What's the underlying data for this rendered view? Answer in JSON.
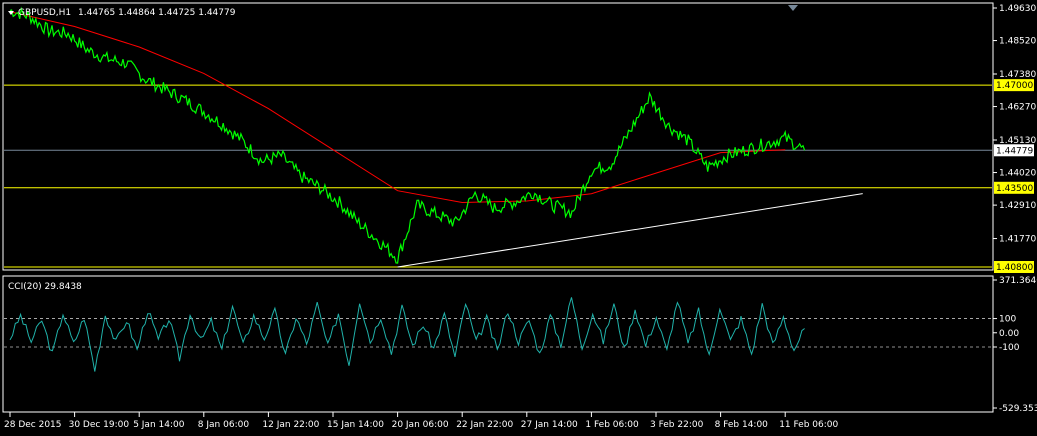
{
  "window": {
    "header_symbol": "GBPUSD,H1",
    "header_ohlc": "1.44765 1.44864 1.44725 1.44779",
    "cci_title": "CCI(20) 29.8438"
  },
  "colors": {
    "background": "#000000",
    "frame": "#ffffff",
    "price": "#00ff00",
    "ma": "#ff0000",
    "cci": "#20b2aa",
    "level_line": "#ffff00",
    "level_badge": "#ffff00",
    "current_line": "#778899",
    "current_badge": "#ffffff",
    "trendline": "#ffffff",
    "grid_dashed": "#c0c0c0"
  },
  "chart_data": [
    {
      "type": "line",
      "name_hint": "price",
      "ylim": [
        1.408,
        1.4963
      ],
      "y_ticks": [
        "1.49630",
        "1.48520",
        "1.47380",
        "1.46270",
        "1.45130",
        "1.44020",
        "1.42910",
        "1.41770"
      ],
      "x_tick_labels": [
        "28 Dec 2015",
        "30 Dec 19:00",
        "5 Jan 14:00",
        "8 Jan 06:00",
        "12 Jan 22:00",
        "15 Jan 14:00",
        "20 Jan 06:00",
        "22 Jan 22:00",
        "27 Jan 14:00",
        "1 Feb 06:00",
        "3 Feb 22:00",
        "8 Feb 14:00",
        "11 Feb 06:00"
      ],
      "x_tick_index": [
        0,
        1,
        2,
        3,
        4,
        5,
        6,
        7,
        8,
        9,
        10,
        11,
        12
      ],
      "price_series": {
        "x": [
          0,
          0.3,
          0.6,
          0.9,
          1.2,
          1.5,
          1.8,
          2.1,
          2.4,
          2.7,
          3.0,
          3.3,
          3.6,
          3.9,
          4.2,
          4.5,
          4.8,
          5.1,
          5.4,
          5.7,
          6.0,
          6.3,
          6.6,
          6.9,
          7.2,
          7.5,
          7.8,
          8.1,
          8.4,
          8.7,
          9.0,
          9.3,
          9.6,
          9.9,
          10.2,
          10.5,
          10.8,
          11.1,
          11.4,
          11.7,
          12.0,
          12.3
        ],
        "y": [
          1.4955,
          1.4935,
          1.4885,
          1.4875,
          1.482,
          1.479,
          1.4775,
          1.472,
          1.4685,
          1.465,
          1.461,
          1.4565,
          1.451,
          1.444,
          1.446,
          1.439,
          1.435,
          1.43,
          1.423,
          1.417,
          1.411,
          1.429,
          1.426,
          1.423,
          1.433,
          1.428,
          1.43,
          1.4335,
          1.429,
          1.4265,
          1.441,
          1.443,
          1.4545,
          1.466,
          1.456,
          1.451,
          1.442,
          1.446,
          1.448,
          1.45,
          1.452,
          1.4478
        ]
      },
      "ma_series": {
        "x": [
          0,
          1,
          2,
          3,
          4,
          5,
          6,
          7,
          8,
          9,
          10,
          11,
          12
        ],
        "y": [
          1.495,
          1.49,
          1.483,
          1.474,
          1.462,
          1.448,
          1.434,
          1.43,
          1.4305,
          1.433,
          1.44,
          1.447,
          1.448
        ]
      },
      "levels": [
        {
          "value": 1.47,
          "label": "1.47000"
        },
        {
          "value": 1.435,
          "label": "1.43500"
        },
        {
          "value": 1.408,
          "label": "1.40800"
        }
      ],
      "current_price": {
        "value": 1.44779,
        "label": "1.44779"
      },
      "trendline": {
        "x": [
          6.0,
          13.2
        ],
        "y": [
          1.408,
          1.433
        ]
      }
    },
    {
      "type": "line",
      "name_hint": "cci",
      "title": "CCI(20) 29.8438",
      "ylim": [
        -529.3536,
        371.3646
      ],
      "y_ticks": [
        "371.3646",
        "100",
        "0.00",
        "-100",
        "-529.3536"
      ],
      "levels": [
        100,
        -100
      ],
      "x_tick_index": [
        0,
        1,
        2,
        3,
        4,
        5,
        6,
        7,
        8,
        9,
        10,
        11,
        12
      ],
      "values": [
        -40,
        120,
        -60,
        90,
        -150,
        140,
        -80,
        110,
        -260,
        130,
        -70,
        90,
        -120,
        160,
        -50,
        100,
        -180,
        140,
        -60,
        80,
        -120,
        190,
        -90,
        120,
        -40,
        150,
        -160,
        110,
        -80,
        200,
        -100,
        140,
        -220,
        230,
        -60,
        120,
        -140,
        180,
        -90,
        60,
        -110,
        130,
        -170,
        210,
        -70,
        100,
        -130,
        160,
        -60,
        90,
        -150,
        120,
        -80,
        250,
        -100,
        140,
        -60,
        200,
        -120,
        170,
        -90,
        110,
        -130,
        230,
        -80,
        150,
        -170,
        190,
        -60,
        100,
        -150,
        200,
        -90,
        110,
        -120,
        30
      ]
    }
  ]
}
